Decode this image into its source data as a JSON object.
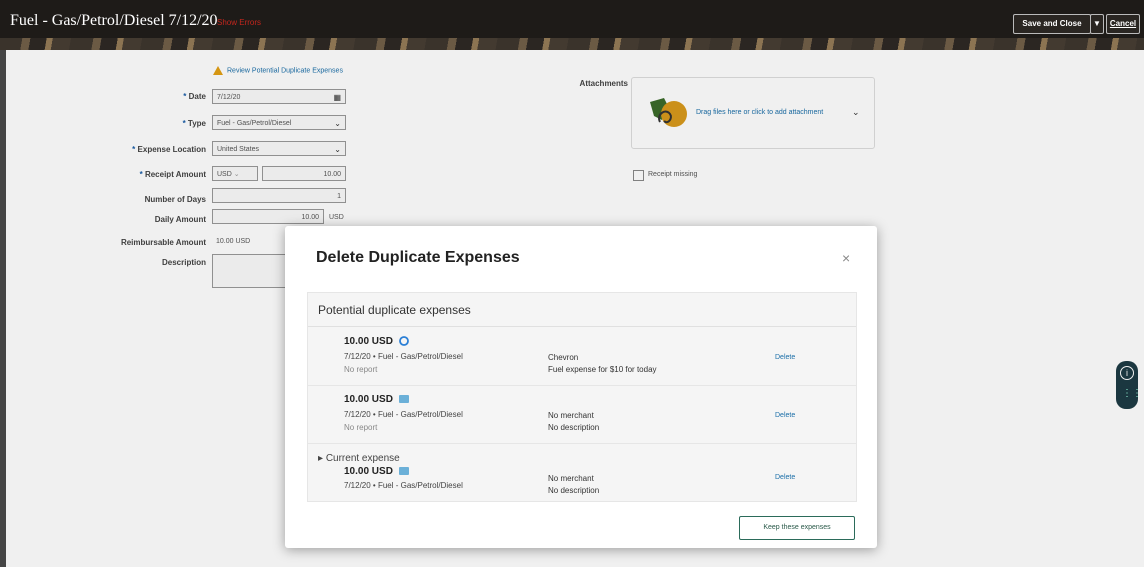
{
  "header": {
    "title": "Fuel - Gas/Petrol/Diesel 7/12/20",
    "show_errors": "Show Errors",
    "save_close": "Save and Close",
    "dropdown_glyph": "▼",
    "cancel": "Cancel"
  },
  "form": {
    "review_link": "Review Potential Duplicate Expenses",
    "date_label": "Date",
    "date_value": "7/12/20",
    "type_label": "Type",
    "type_value": "Fuel - Gas/Petrol/Diesel",
    "location_label": "Expense Location",
    "location_value": "United States",
    "receipt_label": "Receipt Amount",
    "currency_value": "USD",
    "receipt_value": "10.00",
    "days_label": "Number of Days",
    "days_value": "1",
    "daily_label": "Daily Amount",
    "daily_value": "10.00",
    "daily_currency": "USD",
    "reimb_label": "Reimbursable Amount",
    "reimb_value": "10.00 USD",
    "description_label": "Description",
    "required_mark": "*"
  },
  "attachments": {
    "label": "Attachments",
    "drop_text": "Drag files here or click to add attachment",
    "receipt_missing": "Receipt missing"
  },
  "modal": {
    "title": "Delete Duplicate Expenses",
    "close": "×",
    "section_title": "Potential duplicate expenses",
    "current_label": "Current expense",
    "keep_button": "Keep these expenses",
    "items": [
      {
        "amount": "10.00 USD",
        "line": "7/12/20 • Fuel - Gas/Petrol/Diesel",
        "report": "No report",
        "merchant": "Chevron",
        "description": "Fuel expense for $10 for today",
        "delete": "Delete",
        "icon": "circle-sync-icon"
      },
      {
        "amount": "10.00 USD",
        "line": "7/12/20 • Fuel - Gas/Petrol/Diesel",
        "report": "No report",
        "merchant": "No merchant",
        "description": "No description",
        "delete": "Delete",
        "icon": "card-icon"
      },
      {
        "amount": "10.00 USD",
        "line": "7/12/20 • Fuel - Gas/Petrol/Diesel",
        "merchant": "No merchant",
        "description": "No description",
        "delete": "Delete",
        "icon": "card-icon"
      }
    ]
  },
  "colors": {
    "header_bg": "#1e1b18",
    "link": "#1a6ea8",
    "warning": "#e3a014",
    "error": "#c4261d"
  }
}
